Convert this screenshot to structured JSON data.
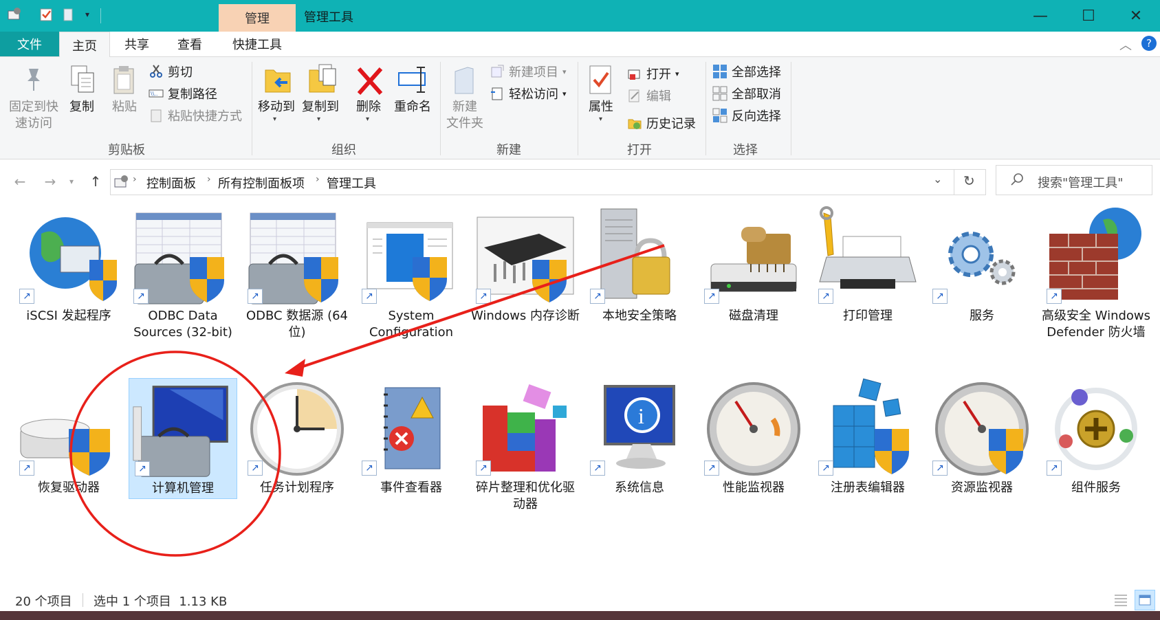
{
  "titlebar": {
    "context_group": "管理",
    "title": "管理工具",
    "minimize": "—",
    "maximize": "☐",
    "close": "✕"
  },
  "tabs": {
    "file": "文件",
    "home": "主页",
    "share": "共享",
    "view": "查看",
    "shortcut_tools": "快捷工具"
  },
  "ribbon": {
    "clipboard": {
      "pin": "固定到快\n速访问",
      "copy": "复制",
      "paste": "粘贴",
      "cut": "剪切",
      "copy_path": "复制路径",
      "paste_shortcut": "粘贴快捷方式",
      "label": "剪贴板"
    },
    "organize": {
      "move_to": "移动到",
      "copy_to": "复制到",
      "delete": "删除",
      "rename": "重命名",
      "label": "组织"
    },
    "new": {
      "new_folder": "新建\n文件夹",
      "new_item": "新建项目",
      "easy_access": "轻松访问",
      "label": "新建"
    },
    "open": {
      "properties": "属性",
      "open": "打开",
      "edit": "编辑",
      "history": "历史记录",
      "label": "打开"
    },
    "select": {
      "select_all": "全部选择",
      "select_none": "全部取消",
      "invert": "反向选择",
      "label": "选择"
    }
  },
  "address": {
    "crumbs": [
      "控制面板",
      "所有控制面板项",
      "管理工具"
    ],
    "search_placeholder": "搜索\"管理工具\""
  },
  "items": [
    {
      "label": "iSCSI 发起程序",
      "icon": "globe-icon"
    },
    {
      "label": "ODBC Data Sources (32-bit)",
      "icon": "toolbox-icon"
    },
    {
      "label": "ODBC 数据源 (64 位)",
      "icon": "toolbox-icon"
    },
    {
      "label": "System Configuration",
      "icon": "window-config-icon"
    },
    {
      "label": "Windows 内存诊断",
      "icon": "memory-chip-icon"
    },
    {
      "label": "本地安全策略",
      "icon": "server-lock-icon"
    },
    {
      "label": "磁盘清理",
      "icon": "disk-brush-icon"
    },
    {
      "label": "打印管理",
      "icon": "printer-icon"
    },
    {
      "label": "服务",
      "icon": "gears-icon"
    },
    {
      "label": "高级安全 Windows Defender 防火墙",
      "icon": "firewall-icon"
    },
    {
      "label": "恢复驱动器",
      "icon": "drive-icon"
    },
    {
      "label": "计算机管理",
      "icon": "computer-toolbox-icon"
    },
    {
      "label": "任务计划程序",
      "icon": "clock-icon"
    },
    {
      "label": "事件查看器",
      "icon": "event-log-icon"
    },
    {
      "label": "碎片整理和优化驱动器",
      "icon": "defrag-icon"
    },
    {
      "label": "系统信息",
      "icon": "info-monitor-icon"
    },
    {
      "label": "性能监视器",
      "icon": "gauge-icon"
    },
    {
      "label": "注册表编辑器",
      "icon": "registry-cubes-icon"
    },
    {
      "label": "资源监视器",
      "icon": "gauge-icon"
    },
    {
      "label": "组件服务",
      "icon": "component-icon"
    }
  ],
  "status": {
    "count": "20 个项目",
    "selection": "选中 1 个项目  1.13 KB"
  },
  "colors": {
    "titlebar": "#0fb2b5",
    "file_tab": "#0e9ea0",
    "context_tab": "#f8d2b4",
    "annotation_red": "#e8201a",
    "selection": "#cce8ff"
  }
}
